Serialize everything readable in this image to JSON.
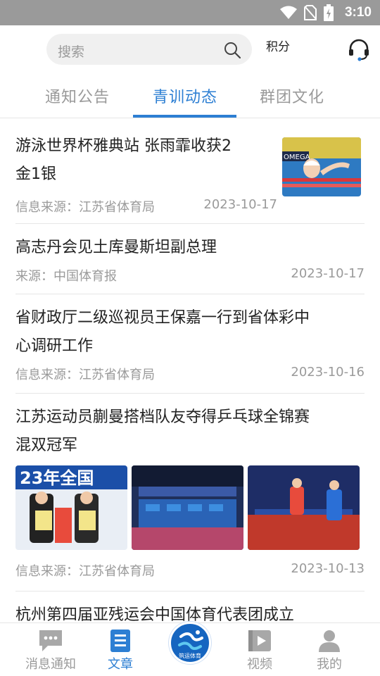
{
  "status_bar": {
    "time": "3:10"
  },
  "header": {
    "search_placeholder": "搜索",
    "points_label": "积分"
  },
  "tabs": [
    {
      "label": "通知公告",
      "active": false
    },
    {
      "label": "青训动态",
      "active": true
    },
    {
      "label": "群团文化",
      "active": false
    }
  ],
  "articles": [
    {
      "title_line1": "游泳世界杯雅典站 张雨霏收获2",
      "title_line2": "金1银",
      "source": "信息来源：江苏省体育局",
      "date": "2023-10-17",
      "image": "swimmer-photo"
    },
    {
      "title": "高志丹会见土库曼斯坦副总理",
      "source": "来源：中国体育报",
      "date": "2023-10-17"
    },
    {
      "title_line1": "省财政厅二级巡视员王保嘉一行到省体彩中",
      "title_line2": "心调研工作",
      "source": "信息来源：江苏省体育局",
      "date": "2023-10-16"
    },
    {
      "title_line1": "江苏运动员蒯曼搭档队友夺得乒乓球全锦赛",
      "title_line2": "混双冠军",
      "source": "信息来源：江苏省体育局",
      "date": "2023-10-13",
      "images": [
        "award-ceremony-photo",
        "arena-photo",
        "match-photo"
      ],
      "image_banner_text": "23年全国"
    },
    {
      "title": "杭州第四届亚残运会中国体育代表团成立"
    }
  ],
  "bottom_nav": {
    "items": [
      {
        "label": "消息通知",
        "icon": "message-icon"
      },
      {
        "label": "文章",
        "icon": "article-icon",
        "active": true
      },
      {
        "label": "视频",
        "icon": "video-icon"
      },
      {
        "label": "我的",
        "icon": "profile-icon"
      }
    ],
    "center_logo_text": "筑运体育"
  },
  "colors": {
    "accent": "#2d7fd3",
    "status_bar": "#9a9a9a",
    "muted_text": "#9a9a9a"
  }
}
